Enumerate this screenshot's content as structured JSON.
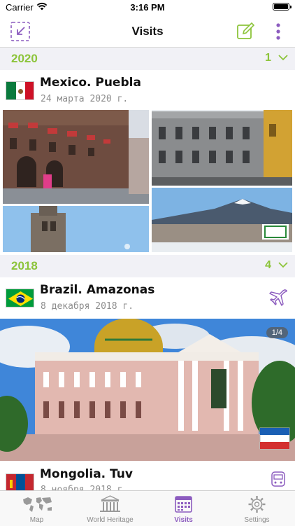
{
  "status_bar": {
    "carrier": "Carrier",
    "time": "3:16 PM"
  },
  "nav": {
    "title": "Visits"
  },
  "sections": [
    {
      "year": "2020",
      "count": "1",
      "entries": [
        {
          "title": "Mexico. Puebla",
          "date": "24 марта 2020 г.",
          "flag": "mexico-flag"
        }
      ]
    },
    {
      "year": "2018",
      "count": "4",
      "entries": [
        {
          "title": "Brazil. Amazonas",
          "date": "8 декабря 2018 г.",
          "flag": "brazil-flag",
          "transport": "airplane-icon",
          "photo_counter": "1/4"
        },
        {
          "title": "Mongolia. Tuv",
          "date": "8 ноября 2018 г.",
          "flag": "mongolia-flag",
          "transport": "train-icon"
        }
      ]
    }
  ],
  "tabs": [
    {
      "label": "Map",
      "icon": "world-map-icon",
      "active": false
    },
    {
      "label": "World Heritage",
      "icon": "heritage-temple-icon",
      "active": false
    },
    {
      "label": "Visits",
      "icon": "calendar-icon",
      "active": true
    },
    {
      "label": "Settings",
      "icon": "gear-icon",
      "active": false
    }
  ],
  "colors": {
    "accent_green": "#8cc43a",
    "accent_purple": "#8c5cbf",
    "section_bg": "#f1f1f6"
  }
}
